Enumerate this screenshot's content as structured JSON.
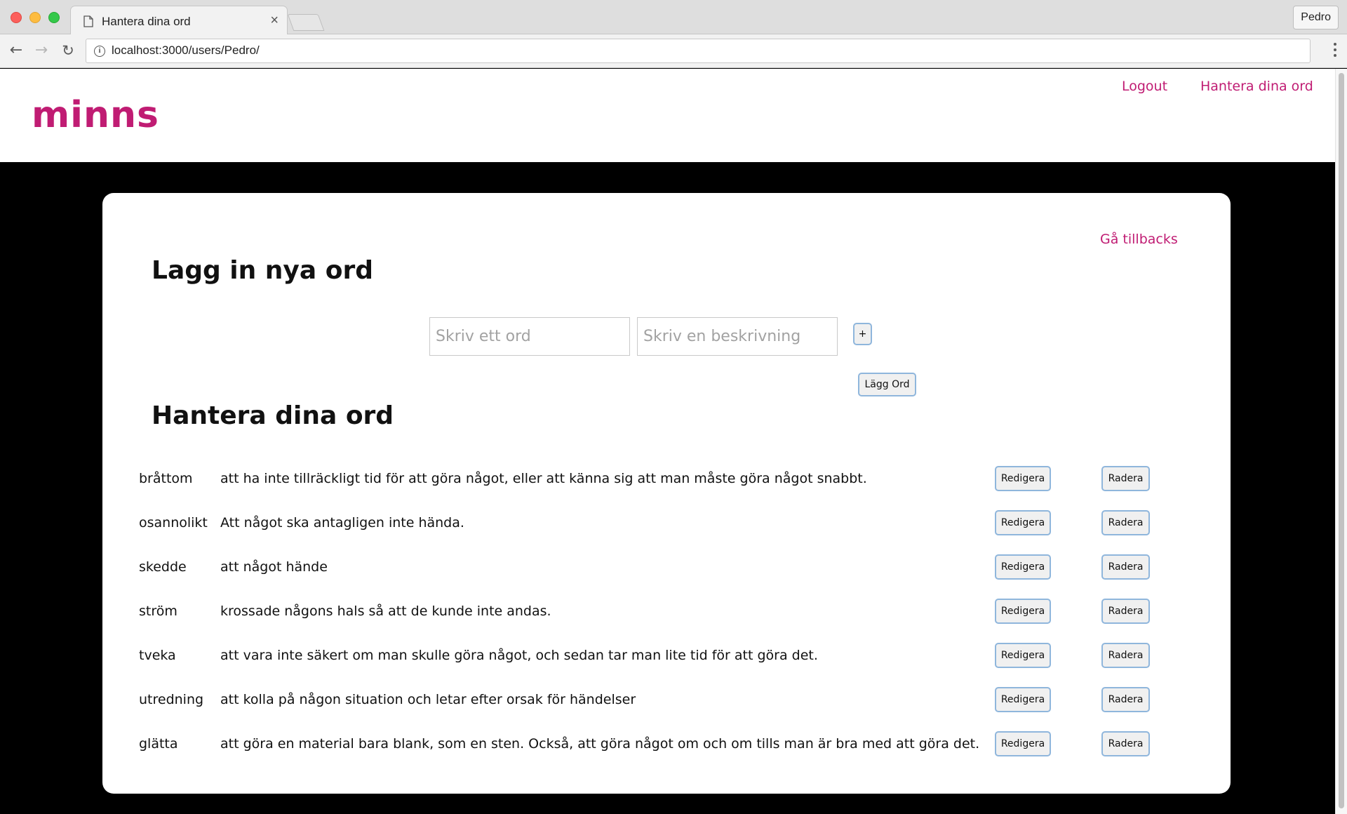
{
  "browser": {
    "tab_title": "Hantera dina ord",
    "tab_close": "×",
    "profile_name": "Pedro",
    "url": "localhost:3000/users/Pedro/"
  },
  "header": {
    "logo_text": "minns",
    "brand_color": "#c01c73",
    "nav": {
      "logout": "Logout",
      "manage": "Hantera dina ord"
    }
  },
  "card": {
    "back_link": "Gå tillbacks",
    "add_heading": "Lagg in nya ord",
    "word_placeholder": "Skriv ett ord",
    "description_placeholder": "Skriv en beskrivning",
    "plus_label": "+",
    "add_button": "Lägg Ord",
    "manage_heading": "Hantera dina ord",
    "edit_label": "Redigera",
    "delete_label": "Radera",
    "words": [
      {
        "word": "bråttom",
        "description": "att ha inte tillräckligt tid för att göra något, eller att känna sig att man måste göra något snabbt."
      },
      {
        "word": "osannolikt",
        "description": "Att något ska antagligen inte hända."
      },
      {
        "word": "skedde",
        "description": "att något hände"
      },
      {
        "word": "ström",
        "description": "krossade någons hals så att de kunde inte andas."
      },
      {
        "word": "tveka",
        "description": "att vara inte säkert om man skulle göra något, och sedan tar man lite tid för att göra det."
      },
      {
        "word": "utredning",
        "description": "att kolla på någon situation och letar efter orsak för händelser"
      },
      {
        "word": "glätta",
        "description": "att göra en material bara blank, som en sten. Också, att göra något om och om tills man är bra med att göra det."
      }
    ]
  }
}
